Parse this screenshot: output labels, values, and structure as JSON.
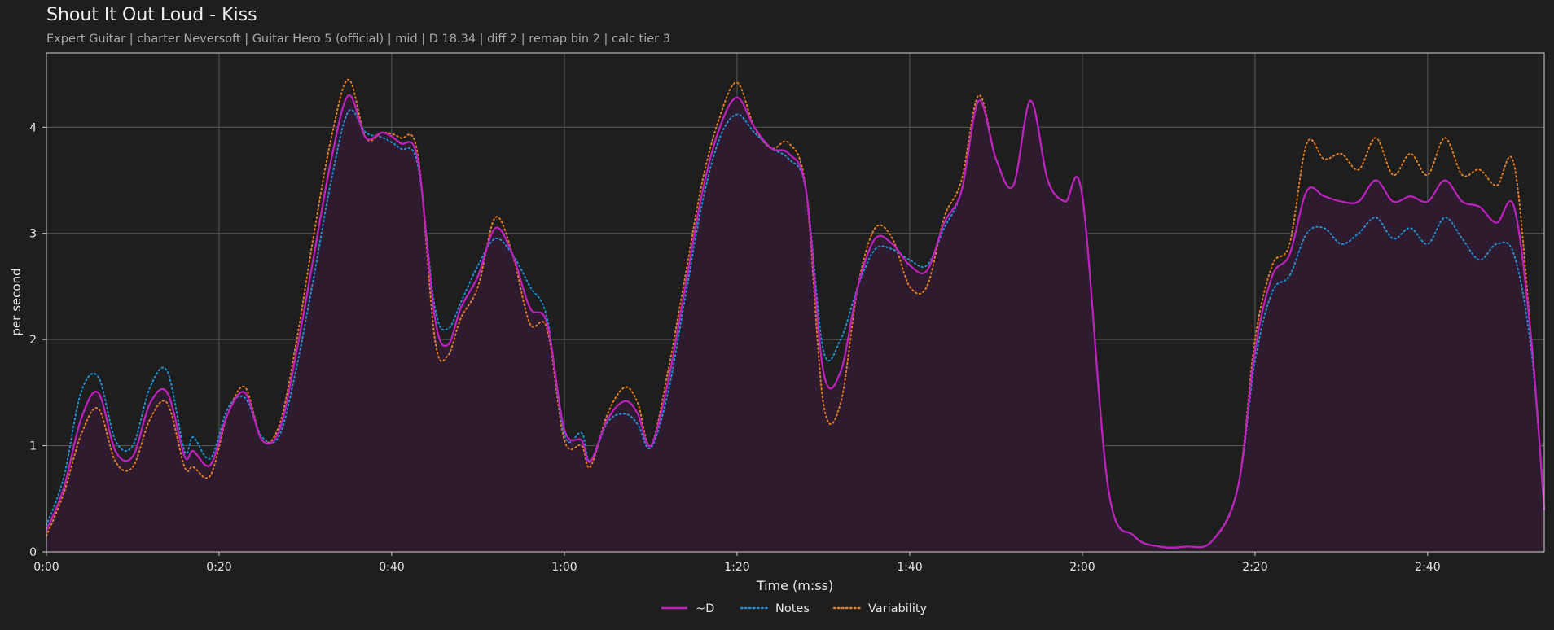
{
  "chart_data": {
    "type": "line",
    "title": "Shout It Out Loud - Kiss",
    "subtitle": "Expert Guitar  |  charter Neversoft  |  Guitar Hero 5 (official)  |  mid  |  D 18.34  |  diff 2  |  remap bin 2  |  calc tier 3",
    "xlabel": "Time (m:ss)",
    "ylabel": "per second",
    "xlim": [
      0,
      173.5
    ],
    "ylim": [
      0,
      4.7
    ],
    "x_unit": "seconds",
    "x_ticks": [
      0,
      20,
      40,
      60,
      80,
      100,
      120,
      140,
      160
    ],
    "x_tick_labels": [
      "0:00",
      "0:20",
      "0:40",
      "1:00",
      "1:20",
      "1:40",
      "2:00",
      "2:20",
      "2:40"
    ],
    "y_ticks": [
      0,
      1,
      2,
      3,
      4
    ],
    "y_tick_labels": [
      "0",
      "1",
      "2",
      "3",
      "4"
    ],
    "grid": true,
    "legend_position": "bottom-center",
    "x": [
      0,
      2,
      4,
      6,
      8,
      10,
      12,
      14,
      16,
      17,
      19,
      21,
      23,
      25,
      27,
      29,
      31,
      33,
      35,
      37,
      39,
      41,
      43,
      45,
      46.5,
      48,
      50,
      52,
      54,
      56,
      58,
      60,
      62,
      63,
      65,
      67,
      68.5,
      70,
      72,
      74,
      76,
      78,
      80,
      82,
      84,
      86,
      88,
      90,
      92,
      94,
      96,
      98,
      100,
      102,
      104,
      106,
      108,
      110,
      112,
      114,
      116,
      118,
      120,
      123,
      126,
      129,
      132,
      135,
      138,
      140,
      142,
      144,
      146,
      148,
      150,
      152,
      154,
      156,
      158,
      160,
      162,
      164,
      166,
      168,
      170,
      172,
      173.5
    ],
    "series": [
      {
        "name": "~D",
        "color": "#c020c0",
        "style": "solid",
        "fill": "#2f1b2f",
        "values": [
          0.2,
          0.6,
          1.25,
          1.5,
          0.95,
          0.9,
          1.4,
          1.5,
          0.9,
          0.95,
          0.82,
          1.3,
          1.5,
          1.05,
          1.15,
          1.9,
          2.8,
          3.7,
          4.3,
          3.9,
          3.95,
          3.85,
          3.7,
          2.2,
          1.95,
          2.3,
          2.6,
          3.05,
          2.8,
          2.3,
          2.15,
          1.15,
          1.05,
          0.85,
          1.25,
          1.42,
          1.3,
          1.0,
          1.6,
          2.5,
          3.4,
          4.0,
          4.28,
          4.0,
          3.8,
          3.75,
          3.4,
          1.7,
          1.7,
          2.5,
          2.95,
          2.9,
          2.7,
          2.65,
          3.1,
          3.4,
          4.25,
          3.7,
          3.45,
          4.25,
          3.5,
          3.3,
          3.35,
          0.6,
          0.15,
          0.05,
          0.05,
          0.1,
          0.6,
          1.9,
          2.6,
          2.8,
          3.4,
          3.35,
          3.3,
          3.3,
          3.5,
          3.3,
          3.35,
          3.3,
          3.5,
          3.3,
          3.25,
          3.1,
          3.25,
          2.0,
          0.4
        ]
      },
      {
        "name": "Notes",
        "color": "#1f8fd0",
        "style": "dotted",
        "values": [
          0.25,
          0.7,
          1.5,
          1.65,
          1.05,
          1.0,
          1.55,
          1.7,
          0.95,
          1.08,
          0.88,
          1.35,
          1.45,
          1.08,
          1.1,
          1.75,
          2.6,
          3.5,
          4.15,
          3.95,
          3.9,
          3.8,
          3.65,
          2.3,
          2.1,
          2.35,
          2.7,
          2.95,
          2.8,
          2.5,
          2.2,
          1.1,
          1.12,
          0.85,
          1.22,
          1.3,
          1.2,
          0.98,
          1.5,
          2.4,
          3.3,
          3.9,
          4.12,
          3.95,
          3.8,
          3.7,
          3.4,
          1.9,
          2.0,
          2.5,
          2.85,
          2.85,
          2.75,
          2.7,
          3.05,
          3.4,
          4.25,
          3.7,
          3.45,
          4.25,
          3.5,
          3.3,
          3.35,
          0.6,
          0.15,
          0.05,
          0.05,
          0.1,
          0.6,
          1.8,
          2.45,
          2.6,
          3.0,
          3.05,
          2.9,
          3.0,
          3.15,
          2.95,
          3.05,
          2.9,
          3.15,
          2.95,
          2.75,
          2.9,
          2.8,
          1.9,
          0.4
        ]
      },
      {
        "name": "Variability",
        "color": "#e07b20",
        "style": "dotted",
        "values": [
          0.15,
          0.55,
          1.1,
          1.35,
          0.85,
          0.8,
          1.25,
          1.4,
          0.8,
          0.8,
          0.72,
          1.3,
          1.55,
          1.05,
          1.2,
          2.0,
          3.0,
          3.9,
          4.45,
          3.9,
          3.95,
          3.9,
          3.75,
          2.0,
          1.85,
          2.2,
          2.5,
          3.15,
          2.8,
          2.15,
          2.1,
          1.05,
          1.0,
          0.8,
          1.3,
          1.55,
          1.4,
          1.0,
          1.7,
          2.6,
          3.5,
          4.1,
          4.42,
          4.0,
          3.8,
          3.85,
          3.4,
          1.4,
          1.4,
          2.5,
          3.05,
          2.95,
          2.5,
          2.5,
          3.15,
          3.5,
          4.3,
          3.7,
          3.45,
          4.25,
          3.5,
          3.3,
          3.35,
          0.6,
          0.15,
          0.05,
          0.05,
          0.1,
          0.6,
          2.0,
          2.7,
          2.9,
          3.85,
          3.7,
          3.75,
          3.6,
          3.9,
          3.55,
          3.75,
          3.55,
          3.9,
          3.55,
          3.6,
          3.45,
          3.65,
          2.0,
          0.4
        ]
      }
    ]
  }
}
